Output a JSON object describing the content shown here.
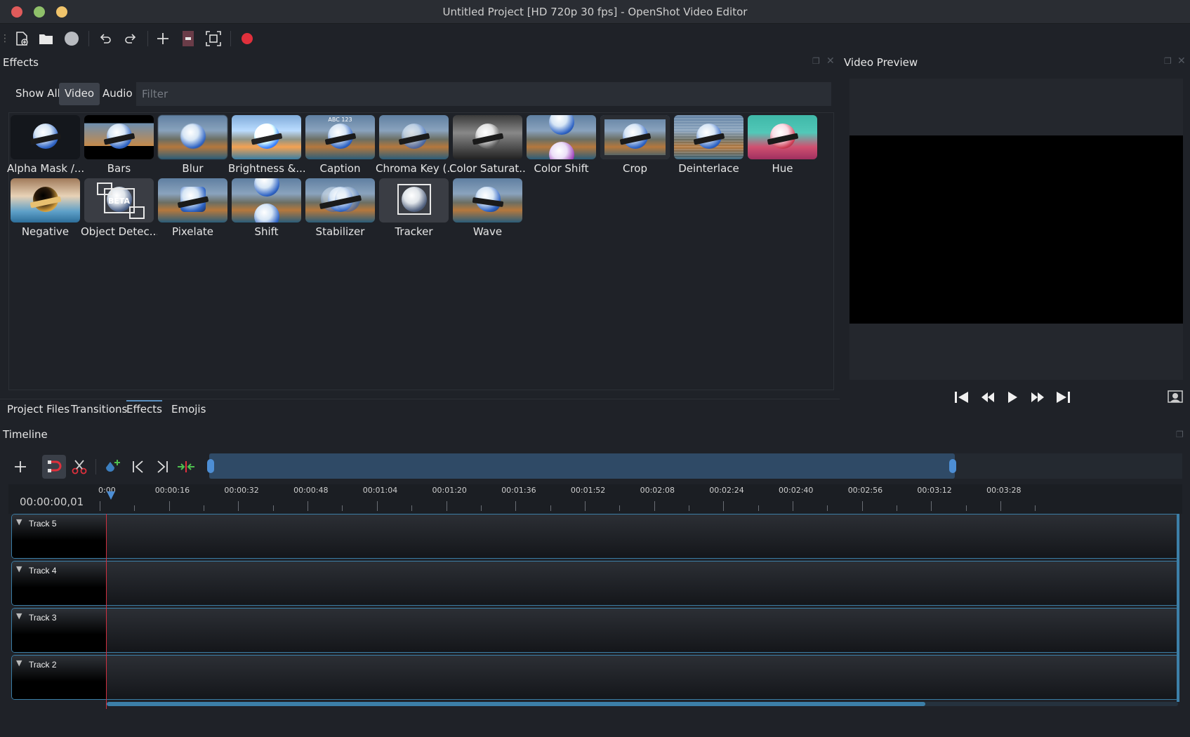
{
  "window": {
    "title": "Untitled Project [HD 720p 30 fps] - OpenShot Video Editor"
  },
  "toolbar": {
    "icons": [
      "new-project-icon",
      "open-project-icon",
      "save-project-icon",
      "undo-icon",
      "redo-icon",
      "import-files-icon",
      "choose-profile-icon",
      "fullscreen-icon",
      "record-icon"
    ],
    "record_color": "#e0303c"
  },
  "effects_panel": {
    "title": "Effects",
    "filter_tabs": [
      {
        "label": "Show All",
        "active": false
      },
      {
        "label": "Video",
        "active": true
      },
      {
        "label": "Audio",
        "active": false
      }
    ],
    "filter_placeholder": "Filter",
    "items": [
      {
        "label": "Alpha Mask /..."
      },
      {
        "label": "Bars"
      },
      {
        "label": "Blur"
      },
      {
        "label": "Brightness &..."
      },
      {
        "label": "Caption",
        "thumb_text": "ABC 123"
      },
      {
        "label": "Chroma Key (..."
      },
      {
        "label": "Color Saturat..."
      },
      {
        "label": "Color Shift"
      },
      {
        "label": "Crop"
      },
      {
        "label": "Deinterlace"
      },
      {
        "label": "Hue"
      },
      {
        "label": "Negative"
      },
      {
        "label": "Object Detec...",
        "thumb_text": "BETA"
      },
      {
        "label": "Pixelate"
      },
      {
        "label": "Shift"
      },
      {
        "label": "Stabilizer"
      },
      {
        "label": "Tracker"
      },
      {
        "label": "Wave"
      }
    ]
  },
  "bottom_tabs": [
    {
      "label": "Project Files",
      "active": false
    },
    {
      "label": "Transitions",
      "active": false
    },
    {
      "label": "Effects",
      "active": true
    },
    {
      "label": "Emojis",
      "active": false
    }
  ],
  "preview": {
    "title": "Video Preview"
  },
  "timeline": {
    "title": "Timeline",
    "timecode": "00:00:00,01",
    "ruler_labels": [
      "0:00",
      "00:00:16",
      "00:00:32",
      "00:00:48",
      "00:01:04",
      "00:01:20",
      "00:01:36",
      "00:01:52",
      "00:02:08",
      "00:02:24",
      "00:02:40",
      "00:02:56",
      "00:03:12",
      "00:03:28"
    ],
    "tracks": [
      {
        "name": "Track 5"
      },
      {
        "name": "Track 4"
      },
      {
        "name": "Track 3"
      },
      {
        "name": "Track 2"
      }
    ],
    "accent_color": "#3c7fa8",
    "playhead_color": "#d03040"
  }
}
